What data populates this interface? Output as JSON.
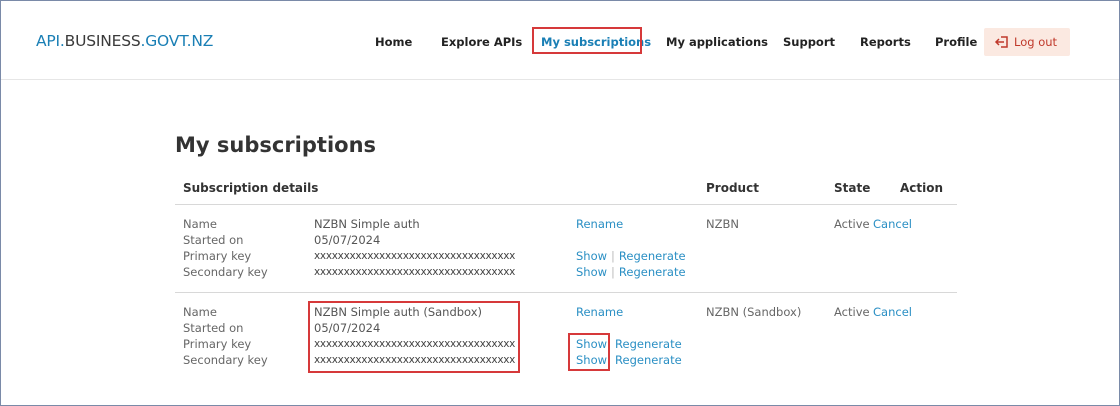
{
  "header": {
    "logo": {
      "part1": "API",
      "dot1": ".",
      "part2": "BUSINESS",
      "dot2": ".",
      "part3": "GOVT.NZ"
    },
    "nav": [
      {
        "label": "Home"
      },
      {
        "label": "Explore APIs"
      },
      {
        "label": "My subscriptions"
      },
      {
        "label": "My applications"
      },
      {
        "label": "Support"
      },
      {
        "label": "Reports"
      },
      {
        "label": "Profile"
      }
    ],
    "logout": {
      "label": "Log out",
      "icon": "logout-icon"
    },
    "accent": "#1a7fb5",
    "highlight": "#d6393a"
  },
  "page": {
    "title": "My subscriptions"
  },
  "table": {
    "headers": {
      "details": "Subscription details",
      "product": "Product",
      "state": "State",
      "action": "Action"
    },
    "field_labels": [
      "Name",
      "Started on",
      "Primary key",
      "Secondary key"
    ],
    "rows": [
      {
        "name": "NZBN Simple auth",
        "started_on": "05/07/2024",
        "primary_key": "xxxxxxxxxxxxxxxxxxxxxxxxxxxxxxxxxx",
        "secondary_key": "xxxxxxxxxxxxxxxxxxxxxxxxxxxxxxxxxx",
        "rename": "Rename",
        "show": "Show",
        "regenerate": "Regenerate",
        "separator": "|",
        "product": "NZBN",
        "state": "Active",
        "action": "Cancel"
      },
      {
        "name": "NZBN Simple auth (Sandbox)",
        "started_on": "05/07/2024",
        "primary_key": "xxxxxxxxxxxxxxxxxxxxxxxxxxxxxxxxxx",
        "secondary_key": "xxxxxxxxxxxxxxxxxxxxxxxxxxxxxxxxxx",
        "rename": "Rename",
        "show": "Show",
        "regenerate": "Regenerate",
        "separator": "",
        "product": "NZBN (Sandbox)",
        "state": "Active",
        "action": "Cancel"
      }
    ]
  }
}
